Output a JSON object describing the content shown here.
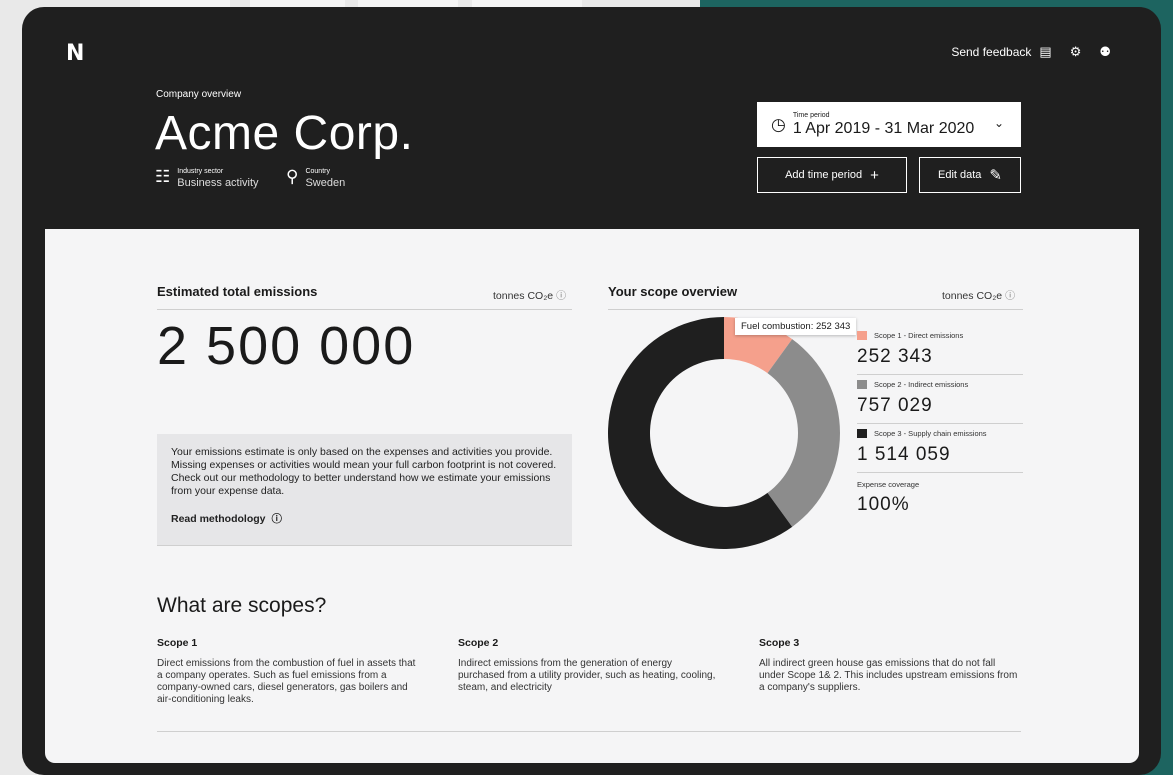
{
  "header": {
    "logo": "N",
    "feedback_label": "Send feedback",
    "overline": "Company overview",
    "company_name": "Acme Corp.",
    "industry": {
      "label": "Industry sector",
      "value": "Business activity"
    },
    "country": {
      "label": "Country",
      "value": "Sweden"
    },
    "time_period": {
      "label": "Time period",
      "value": "1 Apr 2019 - 31 Mar 2020"
    },
    "add_period_label": "Add time period",
    "edit_data_label": "Edit data"
  },
  "emissions": {
    "title": "Estimated total emissions",
    "unit": "tonnes CO₂e",
    "total": "2 500 000",
    "info_text": "Your emissions estimate is only based on the expenses and activities you provide. Missing expenses or activities would mean your full carbon footprint is not covered. Check out our methodology to better understand how we estimate your emissions from your expense data.",
    "read_methodology": "Read methodology"
  },
  "scope_overview": {
    "title": "Your scope overview",
    "unit": "tonnes CO₂e",
    "tooltip": "Fuel combustion: 252 343",
    "expense_coverage_label": "Expense coverage",
    "expense_coverage_value": "100%"
  },
  "chart_data": {
    "type": "pie",
    "variant": "donut",
    "series": [
      {
        "name": "Scope 1 - Direct emissions",
        "value": 252343,
        "display": "252 343",
        "color": "#f5a08c"
      },
      {
        "name": "Scope 2 - Indirect emissions",
        "value": 757029,
        "display": "757 029",
        "color": "#8c8c8c"
      },
      {
        "name": "Scope 3 - Supply chain emissions",
        "value": 1514059,
        "display": "1 514 059",
        "color": "#1f1f1f"
      }
    ]
  },
  "scopes_info": {
    "title": "What are scopes?",
    "items": [
      {
        "heading": "Scope 1",
        "body": "Direct emissions from the combustion of fuel in assets that a company operates. Such as fuel emissions from a company-owned cars, diesel generators, gas boilers and air-conditioning leaks."
      },
      {
        "heading": "Scope 2",
        "body": "Indirect emissions from the generation of energy purchased from a utility provider, such as heating, cooling, steam, and electricity"
      },
      {
        "heading": "Scope 3",
        "body": "All indirect green house gas emissions that do not fall under Scope 1& 2. This includes upstream emissions from a company's suppliers."
      }
    ]
  },
  "icons": [
    "feedback-icon",
    "settings-icon",
    "user-icon",
    "building-icon",
    "location-pin-icon",
    "clock-icon",
    "chevron-down-icon",
    "plus-icon",
    "pencil-icon",
    "help-icon"
  ]
}
